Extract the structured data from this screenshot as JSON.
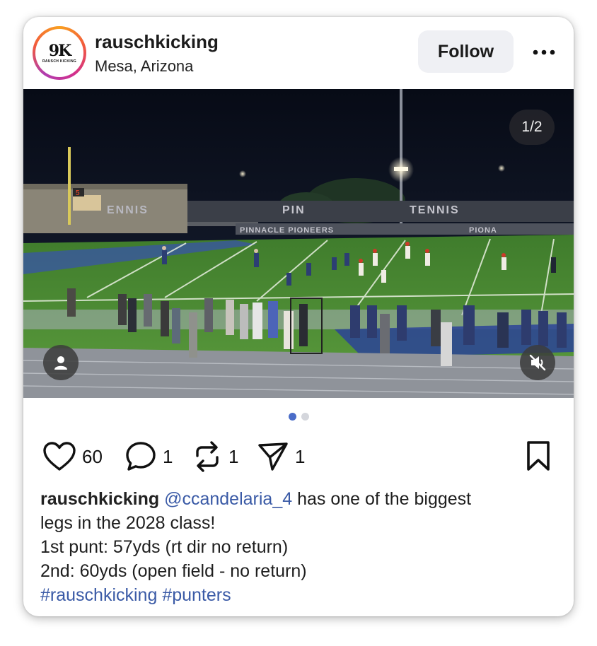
{
  "post": {
    "username": "rauschkicking",
    "location": "Mesa, Arizona",
    "avatar_logo_mark": "9K",
    "avatar_logo_text": "RAUSCH KICKING",
    "follow_label": "Follow",
    "media_counter": "1/2",
    "media_scene": {
      "scoreboard_number": "5",
      "sign_1": "ENNIS",
      "sign_2": "PIN",
      "sign_3": "TENNIS",
      "sign_4": "PINNACLE PIONEERS",
      "sign_5": "PIONA"
    },
    "carousel": {
      "total": 2,
      "active_index": 0
    },
    "stats": {
      "likes": "60",
      "comments": "1",
      "reposts": "1",
      "shares": "1"
    },
    "caption": {
      "author": "rauschkicking",
      "mention": "@ccandelaria_4",
      "line1_rest": " has one of the biggest",
      "line2": "legs in the 2028 class!",
      "line3": "1st punt: 57yds (rt dir no return)",
      "line4": "2nd: 60yds (open field - no return)",
      "hashtag1": "#rauschkicking",
      "hashtag2": "#punters"
    }
  },
  "colors": {
    "link": "#3a5aa6",
    "carousel_dot_active": "#4a6cc8",
    "field_green": "#4f8a34",
    "avatar_ring": "#f25a3c"
  },
  "icons": [
    "more-icon",
    "user-tag-icon",
    "muted-speaker-icon",
    "heart-icon",
    "comment-icon",
    "repost-icon",
    "share-icon",
    "bookmark-icon"
  ]
}
